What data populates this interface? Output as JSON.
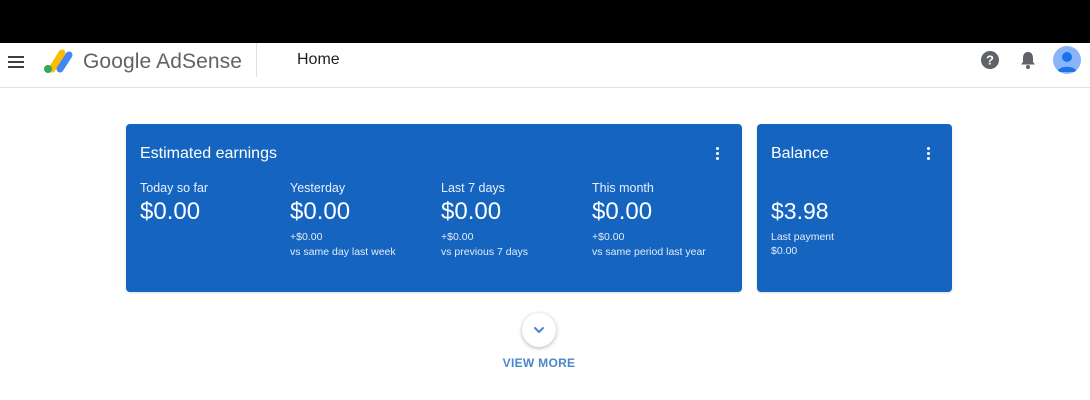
{
  "header": {
    "brand": "Google AdSense",
    "page_title": "Home"
  },
  "icons": {
    "menu": "menu-icon",
    "logo": "adsense-logo",
    "help": "help-icon",
    "notifications": "bell-icon",
    "account": "avatar"
  },
  "colors": {
    "card_bg": "#1565c0",
    "accent": "#4a86c8",
    "logo_yellow": "#fbbc04",
    "logo_blue": "#4285f4",
    "logo_green": "#34a853"
  },
  "earnings": {
    "title": "Estimated earnings",
    "metrics": [
      {
        "label": "Today so far",
        "value": "$0.00"
      },
      {
        "label": "Yesterday",
        "value": "$0.00",
        "delta": "+$0.00",
        "compare": "vs same day last week"
      },
      {
        "label": "Last 7 days",
        "value": "$0.00",
        "delta": "+$0.00",
        "compare": "vs previous 7 days"
      },
      {
        "label": "This month",
        "value": "$0.00",
        "delta": "+$0.00",
        "compare": "vs same period last year"
      }
    ]
  },
  "balance": {
    "title": "Balance",
    "amount": "$3.98",
    "last_payment_label": "Last payment",
    "last_payment_value": "$0.00"
  },
  "view_more": "VIEW MORE"
}
